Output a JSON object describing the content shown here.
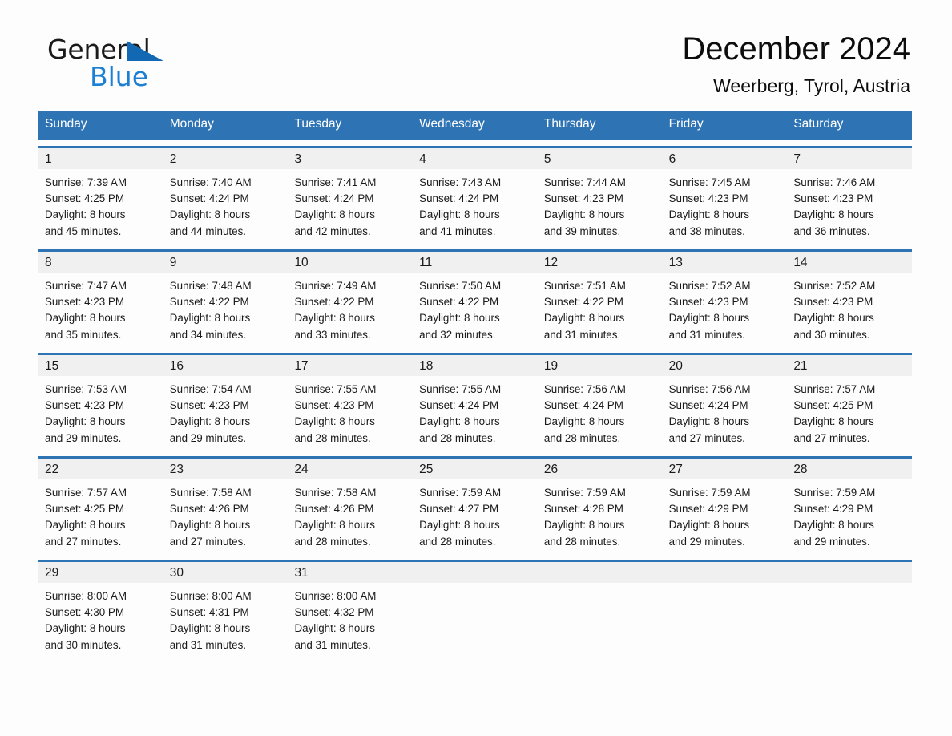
{
  "brand": {
    "word1": "General",
    "word2": "Blue",
    "triangle_color": "#1268b3",
    "blue_text_color": "#1b7fd4"
  },
  "header": {
    "title": "December 2024",
    "subtitle": "Weerberg, Tyrol, Austria"
  },
  "theme": {
    "header_blue": "#2e74b5",
    "daynum_band": "#f0f0f0",
    "page_background": "#fdfdfd"
  },
  "weekdays": [
    "Sunday",
    "Monday",
    "Tuesday",
    "Wednesday",
    "Thursday",
    "Friday",
    "Saturday"
  ],
  "weeks": [
    [
      {
        "day": "1",
        "sunrise": "Sunrise: 7:39 AM",
        "sunset": "Sunset: 4:25 PM",
        "daylight1": "Daylight: 8 hours",
        "daylight2": "and 45 minutes."
      },
      {
        "day": "2",
        "sunrise": "Sunrise: 7:40 AM",
        "sunset": "Sunset: 4:24 PM",
        "daylight1": "Daylight: 8 hours",
        "daylight2": "and 44 minutes."
      },
      {
        "day": "3",
        "sunrise": "Sunrise: 7:41 AM",
        "sunset": "Sunset: 4:24 PM",
        "daylight1": "Daylight: 8 hours",
        "daylight2": "and 42 minutes."
      },
      {
        "day": "4",
        "sunrise": "Sunrise: 7:43 AM",
        "sunset": "Sunset: 4:24 PM",
        "daylight1": "Daylight: 8 hours",
        "daylight2": "and 41 minutes."
      },
      {
        "day": "5",
        "sunrise": "Sunrise: 7:44 AM",
        "sunset": "Sunset: 4:23 PM",
        "daylight1": "Daylight: 8 hours",
        "daylight2": "and 39 minutes."
      },
      {
        "day": "6",
        "sunrise": "Sunrise: 7:45 AM",
        "sunset": "Sunset: 4:23 PM",
        "daylight1": "Daylight: 8 hours",
        "daylight2": "and 38 minutes."
      },
      {
        "day": "7",
        "sunrise": "Sunrise: 7:46 AM",
        "sunset": "Sunset: 4:23 PM",
        "daylight1": "Daylight: 8 hours",
        "daylight2": "and 36 minutes."
      }
    ],
    [
      {
        "day": "8",
        "sunrise": "Sunrise: 7:47 AM",
        "sunset": "Sunset: 4:23 PM",
        "daylight1": "Daylight: 8 hours",
        "daylight2": "and 35 minutes."
      },
      {
        "day": "9",
        "sunrise": "Sunrise: 7:48 AM",
        "sunset": "Sunset: 4:22 PM",
        "daylight1": "Daylight: 8 hours",
        "daylight2": "and 34 minutes."
      },
      {
        "day": "10",
        "sunrise": "Sunrise: 7:49 AM",
        "sunset": "Sunset: 4:22 PM",
        "daylight1": "Daylight: 8 hours",
        "daylight2": "and 33 minutes."
      },
      {
        "day": "11",
        "sunrise": "Sunrise: 7:50 AM",
        "sunset": "Sunset: 4:22 PM",
        "daylight1": "Daylight: 8 hours",
        "daylight2": "and 32 minutes."
      },
      {
        "day": "12",
        "sunrise": "Sunrise: 7:51 AM",
        "sunset": "Sunset: 4:22 PM",
        "daylight1": "Daylight: 8 hours",
        "daylight2": "and 31 minutes."
      },
      {
        "day": "13",
        "sunrise": "Sunrise: 7:52 AM",
        "sunset": "Sunset: 4:23 PM",
        "daylight1": "Daylight: 8 hours",
        "daylight2": "and 31 minutes."
      },
      {
        "day": "14",
        "sunrise": "Sunrise: 7:52 AM",
        "sunset": "Sunset: 4:23 PM",
        "daylight1": "Daylight: 8 hours",
        "daylight2": "and 30 minutes."
      }
    ],
    [
      {
        "day": "15",
        "sunrise": "Sunrise: 7:53 AM",
        "sunset": "Sunset: 4:23 PM",
        "daylight1": "Daylight: 8 hours",
        "daylight2": "and 29 minutes."
      },
      {
        "day": "16",
        "sunrise": "Sunrise: 7:54 AM",
        "sunset": "Sunset: 4:23 PM",
        "daylight1": "Daylight: 8 hours",
        "daylight2": "and 29 minutes."
      },
      {
        "day": "17",
        "sunrise": "Sunrise: 7:55 AM",
        "sunset": "Sunset: 4:23 PM",
        "daylight1": "Daylight: 8 hours",
        "daylight2": "and 28 minutes."
      },
      {
        "day": "18",
        "sunrise": "Sunrise: 7:55 AM",
        "sunset": "Sunset: 4:24 PM",
        "daylight1": "Daylight: 8 hours",
        "daylight2": "and 28 minutes."
      },
      {
        "day": "19",
        "sunrise": "Sunrise: 7:56 AM",
        "sunset": "Sunset: 4:24 PM",
        "daylight1": "Daylight: 8 hours",
        "daylight2": "and 28 minutes."
      },
      {
        "day": "20",
        "sunrise": "Sunrise: 7:56 AM",
        "sunset": "Sunset: 4:24 PM",
        "daylight1": "Daylight: 8 hours",
        "daylight2": "and 27 minutes."
      },
      {
        "day": "21",
        "sunrise": "Sunrise: 7:57 AM",
        "sunset": "Sunset: 4:25 PM",
        "daylight1": "Daylight: 8 hours",
        "daylight2": "and 27 minutes."
      }
    ],
    [
      {
        "day": "22",
        "sunrise": "Sunrise: 7:57 AM",
        "sunset": "Sunset: 4:25 PM",
        "daylight1": "Daylight: 8 hours",
        "daylight2": "and 27 minutes."
      },
      {
        "day": "23",
        "sunrise": "Sunrise: 7:58 AM",
        "sunset": "Sunset: 4:26 PM",
        "daylight1": "Daylight: 8 hours",
        "daylight2": "and 27 minutes."
      },
      {
        "day": "24",
        "sunrise": "Sunrise: 7:58 AM",
        "sunset": "Sunset: 4:26 PM",
        "daylight1": "Daylight: 8 hours",
        "daylight2": "and 28 minutes."
      },
      {
        "day": "25",
        "sunrise": "Sunrise: 7:59 AM",
        "sunset": "Sunset: 4:27 PM",
        "daylight1": "Daylight: 8 hours",
        "daylight2": "and 28 minutes."
      },
      {
        "day": "26",
        "sunrise": "Sunrise: 7:59 AM",
        "sunset": "Sunset: 4:28 PM",
        "daylight1": "Daylight: 8 hours",
        "daylight2": "and 28 minutes."
      },
      {
        "day": "27",
        "sunrise": "Sunrise: 7:59 AM",
        "sunset": "Sunset: 4:29 PM",
        "daylight1": "Daylight: 8 hours",
        "daylight2": "and 29 minutes."
      },
      {
        "day": "28",
        "sunrise": "Sunrise: 7:59 AM",
        "sunset": "Sunset: 4:29 PM",
        "daylight1": "Daylight: 8 hours",
        "daylight2": "and 29 minutes."
      }
    ],
    [
      {
        "day": "29",
        "sunrise": "Sunrise: 8:00 AM",
        "sunset": "Sunset: 4:30 PM",
        "daylight1": "Daylight: 8 hours",
        "daylight2": "and 30 minutes."
      },
      {
        "day": "30",
        "sunrise": "Sunrise: 8:00 AM",
        "sunset": "Sunset: 4:31 PM",
        "daylight1": "Daylight: 8 hours",
        "daylight2": "and 31 minutes."
      },
      {
        "day": "31",
        "sunrise": "Sunrise: 8:00 AM",
        "sunset": "Sunset: 4:32 PM",
        "daylight1": "Daylight: 8 hours",
        "daylight2": "and 31 minutes."
      },
      {
        "day": "",
        "sunrise": "",
        "sunset": "",
        "daylight1": "",
        "daylight2": ""
      },
      {
        "day": "",
        "sunrise": "",
        "sunset": "",
        "daylight1": "",
        "daylight2": ""
      },
      {
        "day": "",
        "sunrise": "",
        "sunset": "",
        "daylight1": "",
        "daylight2": ""
      },
      {
        "day": "",
        "sunrise": "",
        "sunset": "",
        "daylight1": "",
        "daylight2": ""
      }
    ]
  ]
}
